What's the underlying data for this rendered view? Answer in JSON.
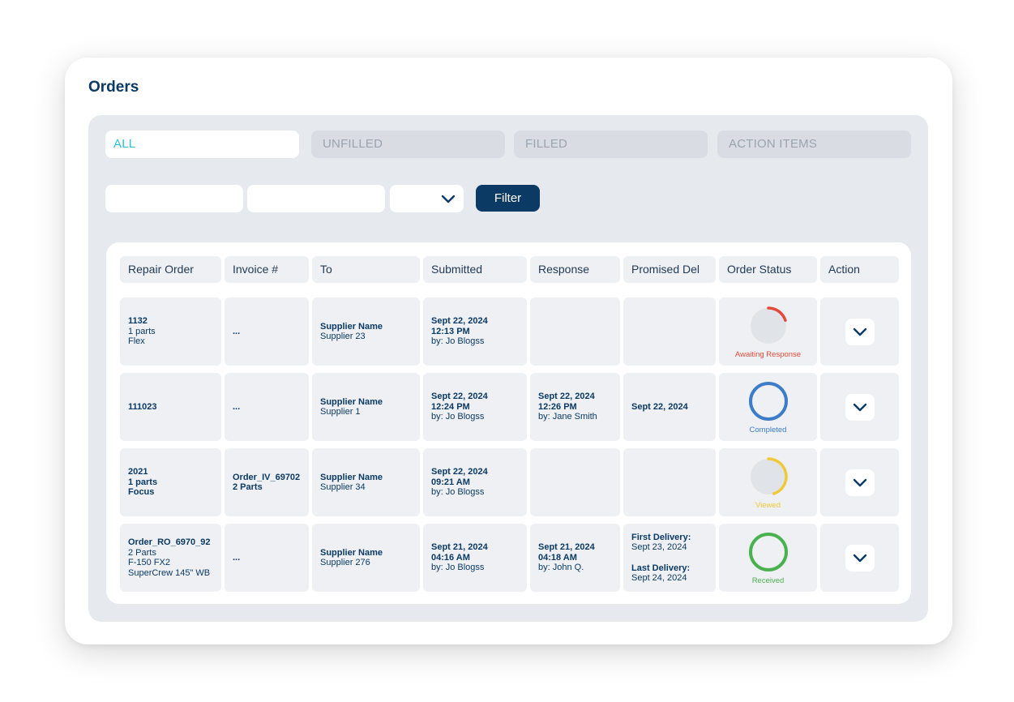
{
  "page_title": "Orders",
  "tabs": [
    {
      "label": "ALL",
      "active": true
    },
    {
      "label": "UNFILLED",
      "active": false
    },
    {
      "label": "FILLED",
      "active": false
    },
    {
      "label": "ACTION ITEMS",
      "active": false
    }
  ],
  "filters": {
    "input_1": "",
    "input_2": "",
    "select_value": "",
    "button_label": "Filter"
  },
  "columns": [
    "Repair Order",
    "Invoice #",
    "To",
    "Submitted",
    "Response",
    "Promised Del",
    "Order Status",
    "Action"
  ],
  "rows": [
    {
      "repair_order": {
        "id": "1132",
        "parts": "1 parts",
        "model": "Flex"
      },
      "invoice": {
        "id": "...",
        "parts": ""
      },
      "to": {
        "label": "Supplier Name",
        "value": "Supplier 23"
      },
      "submitted": {
        "date": "Sept 22, 2024",
        "time": "12:13 PM",
        "by": "by: Jo Blogss"
      },
      "response": {
        "date": "",
        "time": "",
        "by": ""
      },
      "promised": "",
      "status": {
        "label": "Awaiting Response",
        "progress": 0.2,
        "color": "#e24a3b"
      }
    },
    {
      "repair_order": {
        "id": "111023",
        "parts": "",
        "model": ""
      },
      "invoice": {
        "id": "...",
        "parts": ""
      },
      "to": {
        "label": "Supplier Name",
        "value": "Supplier 1"
      },
      "submitted": {
        "date": "Sept 22, 2024",
        "time": "12:24 PM",
        "by": "by: Jo Blogss"
      },
      "response": {
        "date": "Sept 22, 2024",
        "time": "12:26 PM",
        "by": "by: Jane Smith"
      },
      "promised": "Sept 22, 2024",
      "status": {
        "label": "Completed",
        "progress": 1.0,
        "color": "#3d7cc9"
      }
    },
    {
      "repair_order": {
        "id": "2021",
        "parts": "1 parts",
        "model": "Focus"
      },
      "invoice": {
        "id": "Order_IV_69702",
        "parts": "2 Parts"
      },
      "to": {
        "label": "Supplier Name",
        "value": "Supplier 34"
      },
      "submitted": {
        "date": "Sept 22, 2024",
        "time": "09:21 AM",
        "by": "by: Jo Blogss"
      },
      "response": {
        "date": "",
        "time": "",
        "by": ""
      },
      "promised": "",
      "status": {
        "label": "Viewed",
        "progress": 0.45,
        "color": "#f0c93a"
      }
    },
    {
      "repair_order": {
        "id": "Order_RO_6970_92",
        "parts": "2 Parts",
        "model": "F-150 FX2",
        "model2": "SuperCrew 145\" WB"
      },
      "invoice": {
        "id": "...",
        "parts": ""
      },
      "to": {
        "label": "Supplier Name",
        "value": "Supplier 276"
      },
      "submitted": {
        "date": "Sept 21, 2024",
        "time": "04:16 AM",
        "by": "by: Jo Blogss"
      },
      "response": {
        "date": "Sept 21, 2024",
        "time": "04:18 AM",
        "by": "by: John Q."
      },
      "promised_multi": {
        "first_label": "First Delivery:",
        "first_date": "Sept 23, 2024",
        "last_label": "Last Delivery:",
        "last_date": "Sept 24, 2024"
      },
      "status": {
        "label": "Received",
        "progress": 1.0,
        "color": "#4ab14f"
      }
    }
  ],
  "colors": {
    "brand": "#0b3a64",
    "accent": "#2cc1d6"
  }
}
